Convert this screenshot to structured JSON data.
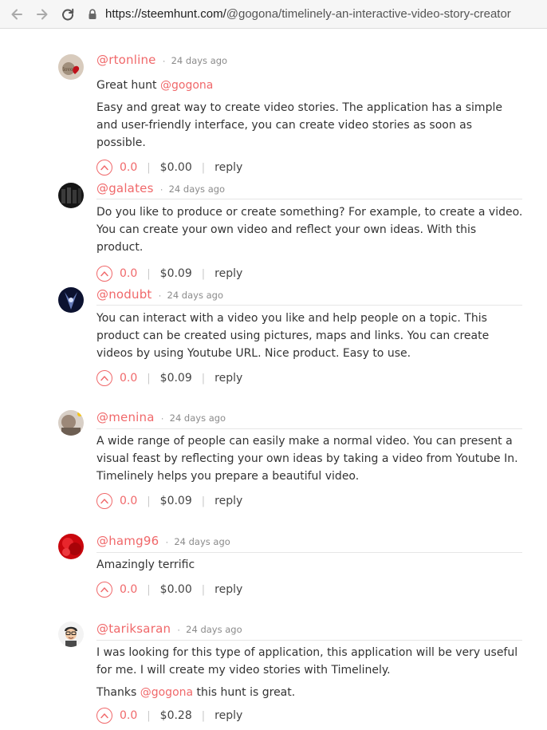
{
  "browser": {
    "url_host": "https://steemhunt.com/",
    "url_path": "@gogona/timelinely-an-interactive-video-story-creator"
  },
  "comments": [
    {
      "user": "@rtonline",
      "time": "24 days ago",
      "paragraphs": [
        [
          {
            "t": "Great hunt "
          },
          {
            "t": "@gogona",
            "m": true
          }
        ],
        [
          {
            "t": "Easy and great way to create video stories. The application has a simple and user-friendly interface, you can create video stories as soon as possible."
          }
        ]
      ],
      "votes": "0.0",
      "payout": "$0.00",
      "reply": "reply",
      "avatar_color": "#c9b9a8"
    },
    {
      "user": "@galates",
      "time": "24 days ago",
      "paragraphs": [
        [
          {
            "t": "Do you like to produce or create something? For example, to create a video. You can create your own video and reflect your own ideas. With this product."
          }
        ]
      ],
      "votes": "0.0",
      "payout": "$0.09",
      "reply": "reply",
      "avatar_color": "#1d1d1d"
    },
    {
      "user": "@nodubt",
      "time": "24 days ago",
      "paragraphs": [
        [
          {
            "t": "You can interact with a video you like and help people on a topic. This product can be created using pictures, maps and links. You can create videos by using Youtube URL. Nice product. Easy to use."
          }
        ]
      ],
      "votes": "0.0",
      "payout": "$0.09",
      "reply": "reply",
      "avatar_color": "#17204a"
    },
    {
      "user": "@menina",
      "time": "24 days ago",
      "paragraphs": [
        [
          {
            "t": "A wide range of people can easily make a normal video. You can present a visual feast by reflecting your own ideas by taking a video from Youtube In. Timelinely helps you prepare a beautiful video."
          }
        ]
      ],
      "votes": "0.0",
      "payout": "$0.09",
      "reply": "reply",
      "avatar_color": "#b8a99a"
    },
    {
      "user": "@hamg96",
      "time": "24 days ago",
      "paragraphs": [
        [
          {
            "t": "Amazingly terrific"
          }
        ]
      ],
      "votes": "0.0",
      "payout": "$0.00",
      "reply": "reply",
      "avatar_color": "#d4141a"
    },
    {
      "user": "@tariksaran",
      "time": "24 days ago",
      "paragraphs": [
        [
          {
            "t": "I was looking for this type of application, this application will be very useful for me. I will create my video stories with Timelinely."
          }
        ],
        [
          {
            "t": "Thanks "
          },
          {
            "t": "@gogona",
            "m": true
          },
          {
            "t": " this hunt is great."
          }
        ]
      ],
      "votes": "0.0",
      "payout": "$0.28",
      "reply": "reply",
      "avatar_color": "#f2f2f2"
    }
  ]
}
